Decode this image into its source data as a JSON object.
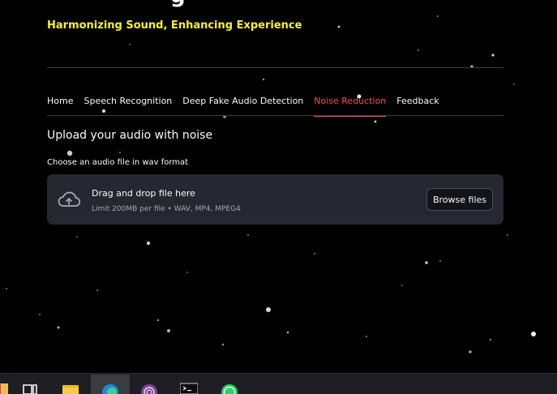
{
  "app": {
    "title_partial": "g",
    "tagline": "Harmonizing Sound, Enhancing Experience"
  },
  "tabs": [
    {
      "label": "Home",
      "active": false
    },
    {
      "label": "Speech Recognition",
      "active": false
    },
    {
      "label": "Deep Fake Audio Detection",
      "active": false
    },
    {
      "label": "Noise Reduction",
      "active": true
    },
    {
      "label": "Feedback",
      "active": false
    }
  ],
  "upload": {
    "section_title": "Upload your audio with noise",
    "label": "Choose an audio file in wav format",
    "drag_text": "Drag and drop file here",
    "limit_text": "Limit 200MB per file • WAV, MP4, MPEG4",
    "browse_label": "Browse files"
  },
  "taskbar": {
    "items": [
      "file-explorer-icon",
      "task-view-icon",
      "folder-icon",
      "edge-icon",
      "tor-icon",
      "terminal-icon",
      "whatsapp-icon"
    ]
  },
  "colors": {
    "accent": "#ff4b4b",
    "tagline": "#f7f230",
    "dropzone_bg": "#262730",
    "background": "#000000"
  }
}
